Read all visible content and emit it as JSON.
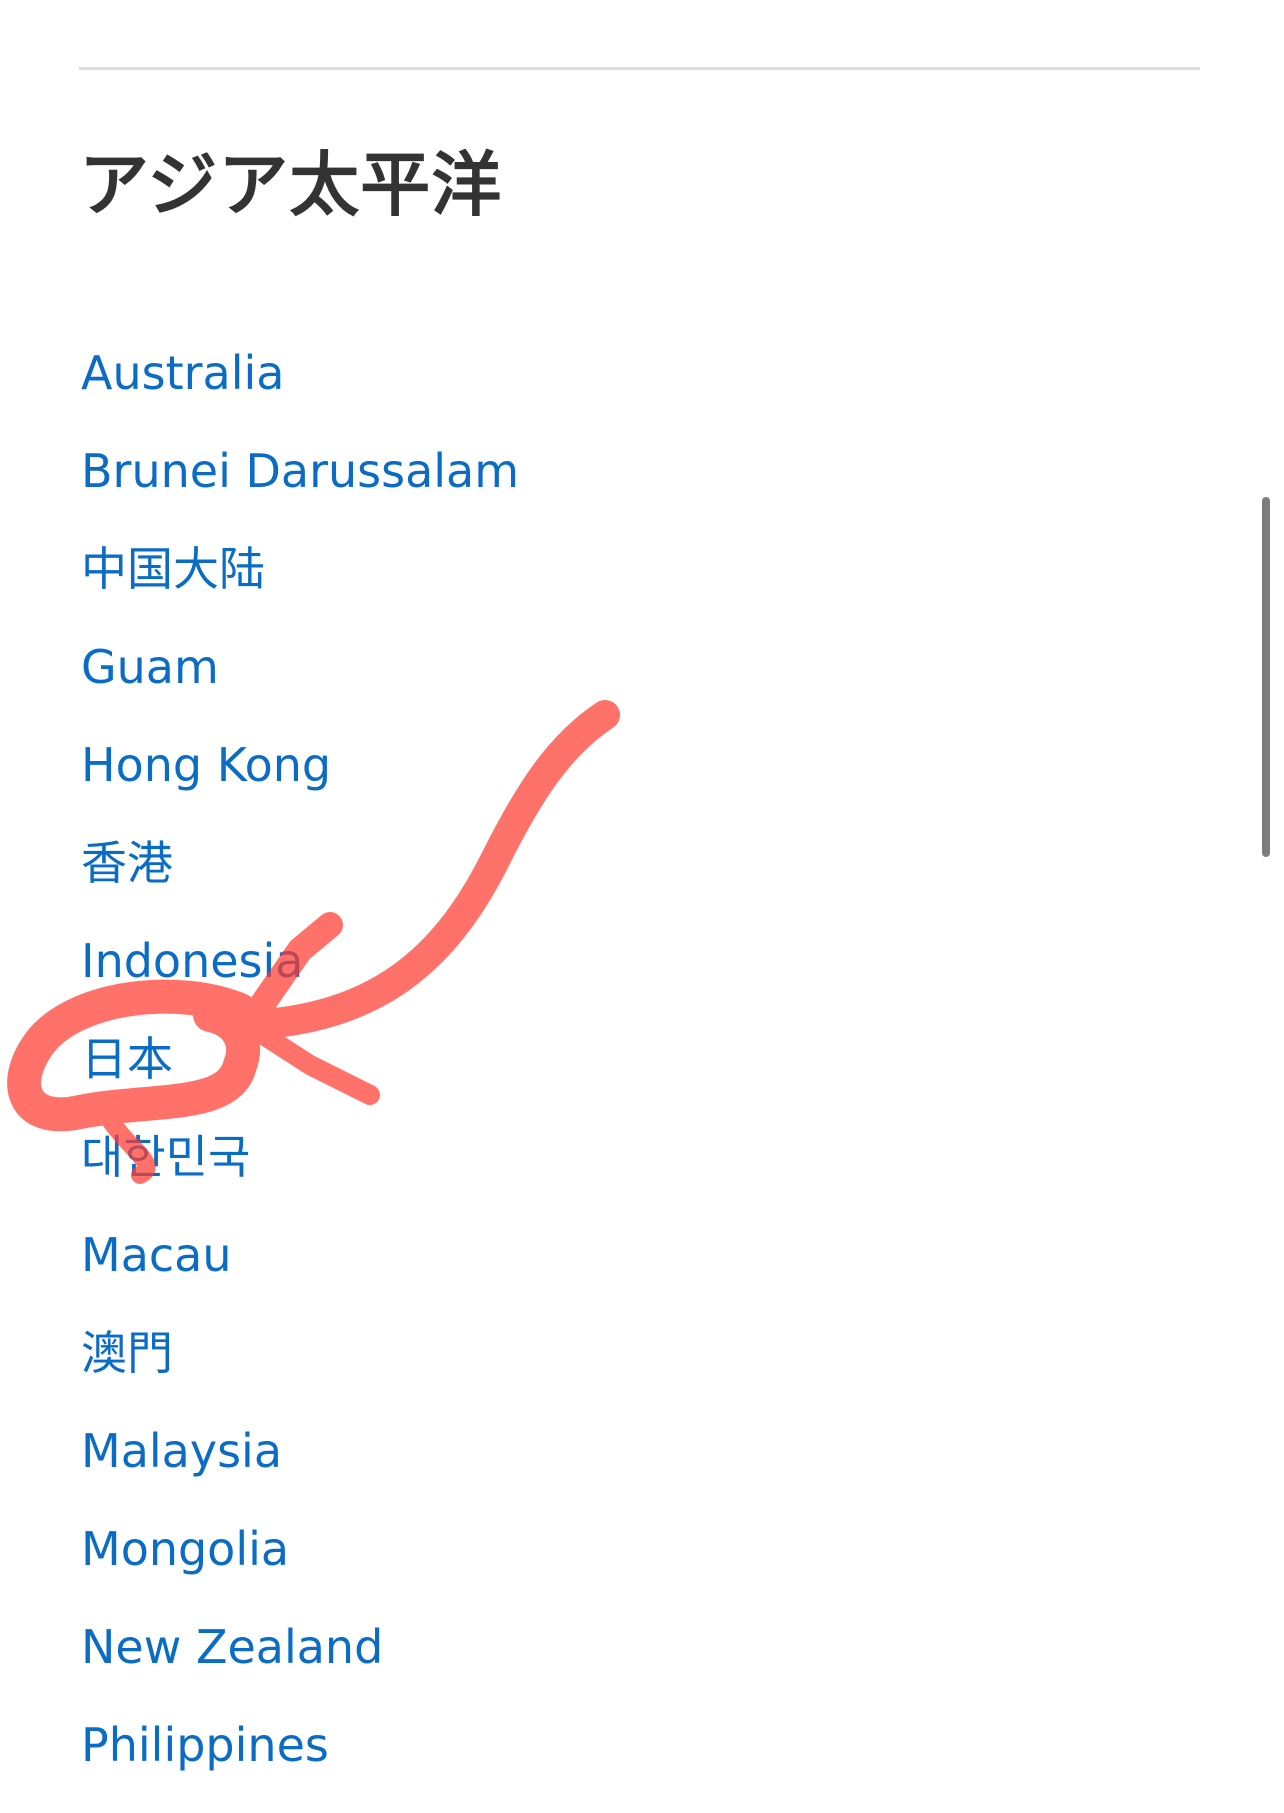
{
  "section": {
    "title": "アジア太平洋"
  },
  "regions": [
    "Australia",
    "Brunei Darussalam",
    "中国大陆",
    "Guam",
    "Hong Kong",
    "香港",
    "Indonesia",
    "日本",
    "대한민국",
    "Macau",
    "澳門",
    "Malaysia",
    "Mongolia",
    "New Zealand",
    "Philippines"
  ],
  "colors": {
    "link": "#0a6cc4",
    "heading": "#333333",
    "annotation": "#ff3b30",
    "divider": "#dcdcdc"
  }
}
